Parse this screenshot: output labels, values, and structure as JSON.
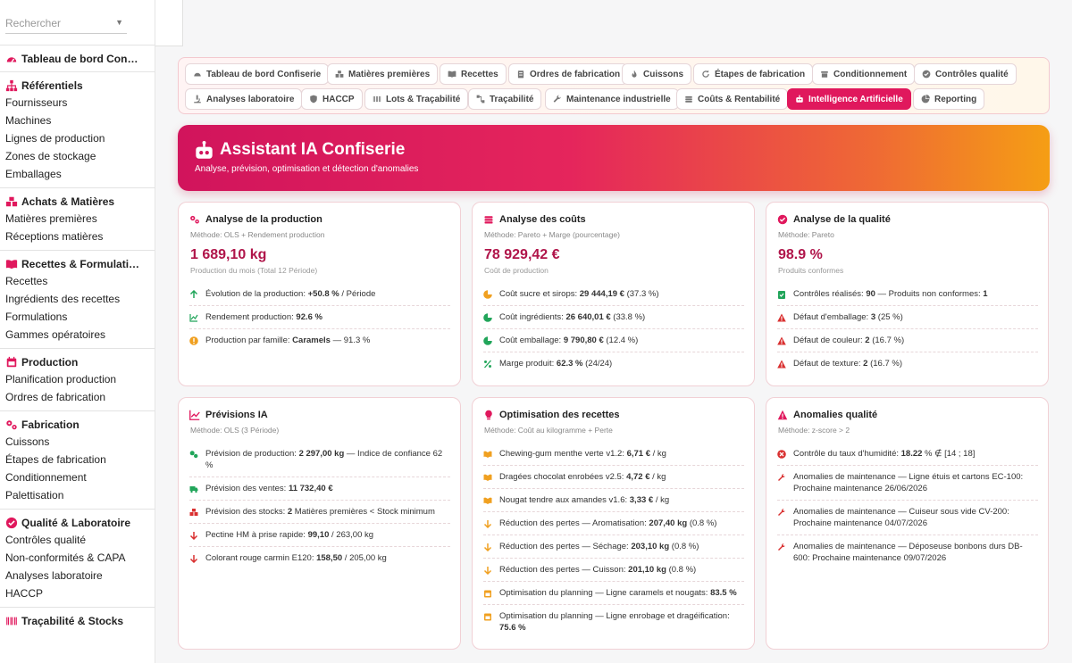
{
  "sidebar": {
    "search_placeholder": "Rechercher",
    "sections": [
      {
        "title": "Tableau de bord Con…",
        "icon": "gauge-icon",
        "items": []
      },
      {
        "title": "Référentiels",
        "icon": "sitemap-icon",
        "items": [
          "Fournisseurs",
          "Machines",
          "Lignes de production",
          "Zones de stockage",
          "Emballages"
        ]
      },
      {
        "title": "Achats & Matières",
        "icon": "boxes-icon",
        "items": [
          "Matières premières",
          "Réceptions matières"
        ]
      },
      {
        "title": "Recettes & Formulati…",
        "icon": "book-icon",
        "items": [
          "Recettes",
          "Ingrédients des recettes",
          "Formulations",
          "Gammes opératoires"
        ]
      },
      {
        "title": "Production",
        "icon": "calendar-icon",
        "items": [
          "Planification production",
          "Ordres de fabrication"
        ]
      },
      {
        "title": "Fabrication",
        "icon": "gears-icon",
        "items": [
          "Cuissons",
          "Étapes de fabrication",
          "Conditionnement",
          "Palettisation"
        ]
      },
      {
        "title": "Qualité & Laboratoire",
        "icon": "check-circle-icon",
        "items": [
          "Contrôles qualité",
          "Non-conformités & CAPA",
          "Analyses laboratoire",
          "HACCP"
        ]
      },
      {
        "title": "Traçabilité & Stocks",
        "icon": "barcode-icon",
        "items": []
      }
    ]
  },
  "tabs": [
    {
      "label": "Tableau de bord Confiserie",
      "icon": "gauge-icon"
    },
    {
      "label": "Matières premières",
      "icon": "boxes-icon"
    },
    {
      "label": "Recettes",
      "icon": "book-icon"
    },
    {
      "label": "Ordres de fabrication",
      "icon": "clipboard-icon"
    },
    {
      "label": "Cuissons",
      "icon": "fire-icon"
    },
    {
      "label": "Étapes de fabrication",
      "icon": "refresh-icon"
    },
    {
      "label": "Conditionnement",
      "icon": "box-icon"
    },
    {
      "label": "Contrôles qualité",
      "icon": "check-circle-icon"
    },
    {
      "label": "Analyses laboratoire",
      "icon": "microscope-icon"
    },
    {
      "label": "HACCP",
      "icon": "shield-icon"
    },
    {
      "label": "Lots & Traçabilité",
      "icon": "barcode-icon"
    },
    {
      "label": "Traçabilité",
      "icon": "diagram-icon"
    },
    {
      "label": "Maintenance industrielle",
      "icon": "wrench-icon"
    },
    {
      "label": "Coûts & Rentabilité",
      "icon": "coins-icon"
    },
    {
      "label": "Intelligence Artificielle",
      "icon": "robot-icon",
      "active": true
    },
    {
      "label": "Reporting",
      "icon": "pie-icon"
    }
  ],
  "hero": {
    "title": "Assistant IA Confiserie",
    "subtitle": "Analyse, prévision, optimisation et détection d'anomalies"
  },
  "cards": {
    "production": {
      "title": "Analyse de la production",
      "method": "Méthode: OLS + Rendement production",
      "value": "1 689,10 kg",
      "value_sub": "Production du mois (Total 12 Période)",
      "rows": [
        {
          "pre": "Évolution de la production: ",
          "bold": "+50.8 %",
          "post": " / Période"
        },
        {
          "pre": "Rendement production: ",
          "bold": "92.6 %",
          "post": ""
        },
        {
          "pre": "Production par famille: ",
          "bold": "Caramels",
          "post": " — 91.3 %"
        }
      ]
    },
    "costs": {
      "title": "Analyse des coûts",
      "method": "Méthode: Pareto + Marge (pourcentage)",
      "value": "78 929,42 €",
      "value_sub": "Coût de production",
      "rows": [
        {
          "pre": "Coût sucre et sirops: ",
          "bold": "29 444,19 €",
          "post": " (37.3 %)"
        },
        {
          "pre": "Coût ingrédients: ",
          "bold": "26 640,01 €",
          "post": " (33.8 %)"
        },
        {
          "pre": "Coût emballage: ",
          "bold": "9 790,80 €",
          "post": " (12.4 %)"
        },
        {
          "pre": "Marge produit: ",
          "bold": "62.3 %",
          "post": " (24/24)"
        }
      ]
    },
    "quality": {
      "title": "Analyse de la qualité",
      "method": "Méthode: Pareto",
      "value": "98.9 %",
      "value_sub": "Produits conformes",
      "rows": [
        {
          "pre": "Contrôles réalisés: ",
          "bold": "90",
          "post": " — Produits non conformes: ",
          "bold2": "1"
        },
        {
          "pre": "Défaut d'emballage: ",
          "bold": "3",
          "post": " (25 %)"
        },
        {
          "pre": "Défaut de couleur: ",
          "bold": "2",
          "post": " (16.7 %)"
        },
        {
          "pre": "Défaut de texture: ",
          "bold": "2",
          "post": " (16.7 %)"
        }
      ]
    },
    "forecast": {
      "title": "Prévisions IA",
      "method": "Méthode: OLS (3 Période)",
      "rows": [
        {
          "pre": "Prévision de production: ",
          "bold": "2 297,00 kg",
          "post": " — Indice de confiance 62 %"
        },
        {
          "pre": "Prévision des ventes: ",
          "bold": "11 732,40 €",
          "post": ""
        },
        {
          "pre": "Prévision des stocks: ",
          "bold": "2",
          "post": " Matières premières < Stock minimum"
        },
        {
          "pre": "Pectine HM à prise rapide: ",
          "bold": "99,10",
          "post": " / 263,00 kg"
        },
        {
          "pre": "Colorant rouge carmin E120: ",
          "bold": "158,50",
          "post": " / 205,00 kg"
        }
      ]
    },
    "recipes": {
      "title": "Optimisation des recettes",
      "method": "Méthode: Coût au kilogramme + Perte",
      "rows": [
        {
          "pre": "Chewing-gum menthe verte v1.2: ",
          "bold": "6,71 €",
          "post": " / kg"
        },
        {
          "pre": "Dragées chocolat enrobées v2.5: ",
          "bold": "4,72 €",
          "post": " / kg"
        },
        {
          "pre": "Nougat tendre aux amandes v1.6: ",
          "bold": "3,33 €",
          "post": " / kg"
        },
        {
          "pre": "Réduction des pertes — Aromatisation: ",
          "bold": "207,40 kg",
          "post": " (0.8 %)"
        },
        {
          "pre": "Réduction des pertes — Séchage: ",
          "bold": "203,10 kg",
          "post": " (0.8 %)"
        },
        {
          "pre": "Réduction des pertes — Cuisson: ",
          "bold": "201,10 kg",
          "post": " (0.8 %)"
        },
        {
          "pre": "Optimisation du planning — Ligne caramels et nougats: ",
          "bold": "83.5 %",
          "post": ""
        },
        {
          "pre": "Optimisation du planning — Ligne enrobage et dragéification: ",
          "bold": "75.6 %",
          "post": ""
        }
      ]
    },
    "anomalies": {
      "title": "Anomalies qualité",
      "method": "Méthode: z-score > 2",
      "rows": [
        {
          "pre": "Contrôle du taux d'humidité: ",
          "bold": "18.22",
          "post": " % ∉ [14 ; 18]"
        },
        {
          "pre": "Anomalies de maintenance — Ligne étuis et cartons EC-100: Prochaine maintenance 26/06/2026",
          "bold": "",
          "post": ""
        },
        {
          "pre": "Anomalies de maintenance — Cuiseur sous vide CV-200: Prochaine maintenance 04/07/2026",
          "bold": "",
          "post": ""
        },
        {
          "pre": "Anomalies de maintenance — Déposeuse bonbons durs DB-600: Prochaine maintenance 09/07/2026",
          "bold": "",
          "post": ""
        }
      ]
    }
  },
  "colors": {
    "accent": "#e0185d",
    "accent_dark": "#b0154a",
    "gradient_end": "#f59e14",
    "green": "#21a55a",
    "orange": "#f0a020",
    "red": "#d93030"
  }
}
